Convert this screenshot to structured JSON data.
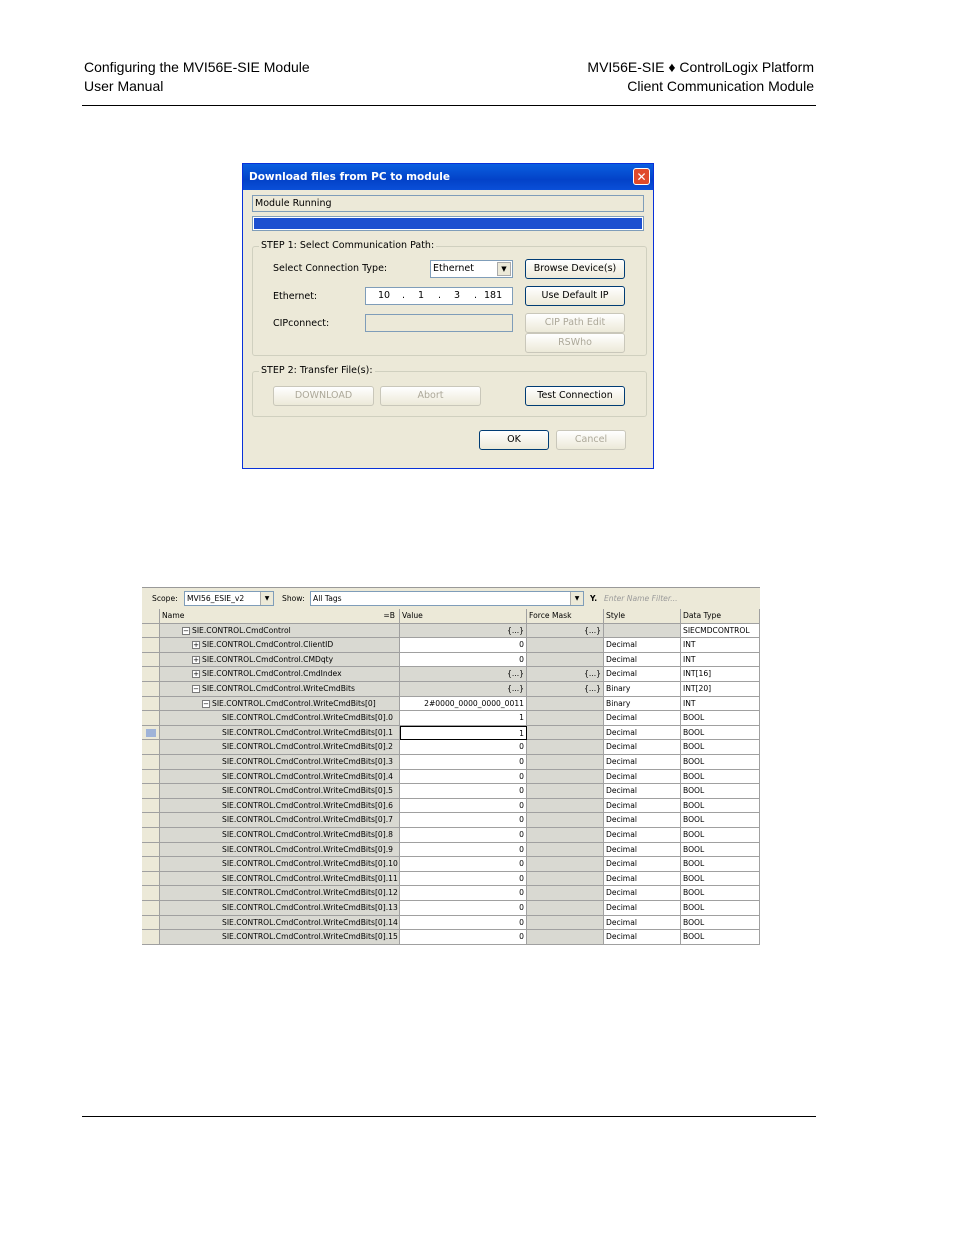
{
  "header": {
    "left_line1": "Configuring the MVI56E-SIE Module",
    "left_line2": "User Manual",
    "right_line1": "MVI56E-SIE ♦ ControlLogix Platform",
    "right_line2": "Client Communication Module"
  },
  "dialog": {
    "title": "Download files from PC to module",
    "close_glyph": "✕",
    "status": "Module Running",
    "progress": 1.0,
    "step1_legend": "STEP 1: Select Communication Path:",
    "conn_type_label": "Select Connection Type:",
    "conn_type_value": "Ethernet",
    "browse_button": "Browse Device(s)",
    "ethernet_label": "Ethernet:",
    "ip": [
      "10",
      "1",
      "3",
      "181"
    ],
    "ip_dot": ".",
    "default_ip_button": "Use Default IP",
    "cip_label": "CIPconnect:",
    "cip_edit_button": "CIP Path Edit",
    "rswho_button": "RSWho",
    "step2_legend": "STEP 2: Transfer File(s):",
    "download_button": "DOWNLOAD",
    "abort_button": "Abort",
    "test_button": "Test Connection",
    "ok_button": "OK",
    "cancel_button": "Cancel",
    "arrow_glyph": "▼"
  },
  "tag_editor": {
    "scope_label": "Scope:",
    "scope_value": "MVI56_ESIE_v2",
    "show_label": "Show:",
    "show_value": "All Tags",
    "filter_icon_glyph": "Y.",
    "filter_placeholder": "Enter Name Filter...",
    "columns": {
      "name": "Name",
      "name_sort": "=B",
      "value": "Value",
      "force_mask": "Force Mask",
      "style": "Style",
      "data_type": "Data Type"
    },
    "rows": [
      {
        "name": "SIE.CONTROL.CmdControl",
        "value": "{...}",
        "force": "{...}",
        "style": "",
        "type": "SIECMDCONTROL",
        "tree": "−",
        "indent": 0
      },
      {
        "name": "SIE.CONTROL.CmdControl.ClientID",
        "value": "0",
        "force": "",
        "style": "Decimal",
        "type": "INT",
        "tree": "+",
        "indent": 1
      },
      {
        "name": "SIE.CONTROL.CmdControl.CMDqty",
        "value": "0",
        "force": "",
        "style": "Decimal",
        "type": "INT",
        "tree": "+",
        "indent": 1
      },
      {
        "name": "SIE.CONTROL.CmdControl.CmdIndex",
        "value": "{...}",
        "force": "{...}",
        "style": "Decimal",
        "type": "INT[16]",
        "tree": "+",
        "indent": 1
      },
      {
        "name": "SIE.CONTROL.CmdControl.WriteCmdBits",
        "value": "{...}",
        "force": "{...}",
        "style": "Binary",
        "type": "INT[20]",
        "tree": "−",
        "indent": 1
      },
      {
        "name": "SIE.CONTROL.CmdControl.WriteCmdBits[0]",
        "value": "2#0000_0000_0000_0011",
        "force": "",
        "style": "Binary",
        "type": "INT",
        "tree": "−",
        "indent": 2
      },
      {
        "name": "SIE.CONTROL.CmdControl.WriteCmdBits[0].0",
        "value": "1",
        "force": "",
        "style": "Decimal",
        "type": "BOOL",
        "tree": "",
        "indent": 3
      },
      {
        "name": "SIE.CONTROL.CmdControl.WriteCmdBits[0].1",
        "value": "1",
        "force": "",
        "style": "Decimal",
        "type": "BOOL",
        "tree": "",
        "indent": 3,
        "selected": true
      },
      {
        "name": "SIE.CONTROL.CmdControl.WriteCmdBits[0].2",
        "value": "0",
        "force": "",
        "style": "Decimal",
        "type": "BOOL",
        "tree": "",
        "indent": 3
      },
      {
        "name": "SIE.CONTROL.CmdControl.WriteCmdBits[0].3",
        "value": "0",
        "force": "",
        "style": "Decimal",
        "type": "BOOL",
        "tree": "",
        "indent": 3
      },
      {
        "name": "SIE.CONTROL.CmdControl.WriteCmdBits[0].4",
        "value": "0",
        "force": "",
        "style": "Decimal",
        "type": "BOOL",
        "tree": "",
        "indent": 3
      },
      {
        "name": "SIE.CONTROL.CmdControl.WriteCmdBits[0].5",
        "value": "0",
        "force": "",
        "style": "Decimal",
        "type": "BOOL",
        "tree": "",
        "indent": 3
      },
      {
        "name": "SIE.CONTROL.CmdControl.WriteCmdBits[0].6",
        "value": "0",
        "force": "",
        "style": "Decimal",
        "type": "BOOL",
        "tree": "",
        "indent": 3
      },
      {
        "name": "SIE.CONTROL.CmdControl.WriteCmdBits[0].7",
        "value": "0",
        "force": "",
        "style": "Decimal",
        "type": "BOOL",
        "tree": "",
        "indent": 3
      },
      {
        "name": "SIE.CONTROL.CmdControl.WriteCmdBits[0].8",
        "value": "0",
        "force": "",
        "style": "Decimal",
        "type": "BOOL",
        "tree": "",
        "indent": 3
      },
      {
        "name": "SIE.CONTROL.CmdControl.WriteCmdBits[0].9",
        "value": "0",
        "force": "",
        "style": "Decimal",
        "type": "BOOL",
        "tree": "",
        "indent": 3
      },
      {
        "name": "SIE.CONTROL.CmdControl.WriteCmdBits[0].10",
        "value": "0",
        "force": "",
        "style": "Decimal",
        "type": "BOOL",
        "tree": "",
        "indent": 3
      },
      {
        "name": "SIE.CONTROL.CmdControl.WriteCmdBits[0].11",
        "value": "0",
        "force": "",
        "style": "Decimal",
        "type": "BOOL",
        "tree": "",
        "indent": 3
      },
      {
        "name": "SIE.CONTROL.CmdControl.WriteCmdBits[0].12",
        "value": "0",
        "force": "",
        "style": "Decimal",
        "type": "BOOL",
        "tree": "",
        "indent": 3
      },
      {
        "name": "SIE.CONTROL.CmdControl.WriteCmdBits[0].13",
        "value": "0",
        "force": "",
        "style": "Decimal",
        "type": "BOOL",
        "tree": "",
        "indent": 3
      },
      {
        "name": "SIE.CONTROL.CmdControl.WriteCmdBits[0].14",
        "value": "0",
        "force": "",
        "style": "Decimal",
        "type": "BOOL",
        "tree": "",
        "indent": 3
      },
      {
        "name": "SIE.CONTROL.CmdControl.WriteCmdBits[0].15",
        "value": "0",
        "force": "",
        "style": "Decimal",
        "type": "BOOL",
        "tree": "",
        "indent": 3
      }
    ]
  },
  "colors": {
    "title_bar": "#0342c8",
    "progress_fill": "#1c4fd0",
    "dialog_bg": "#ece9d8",
    "close_button": "#e04a2a"
  }
}
